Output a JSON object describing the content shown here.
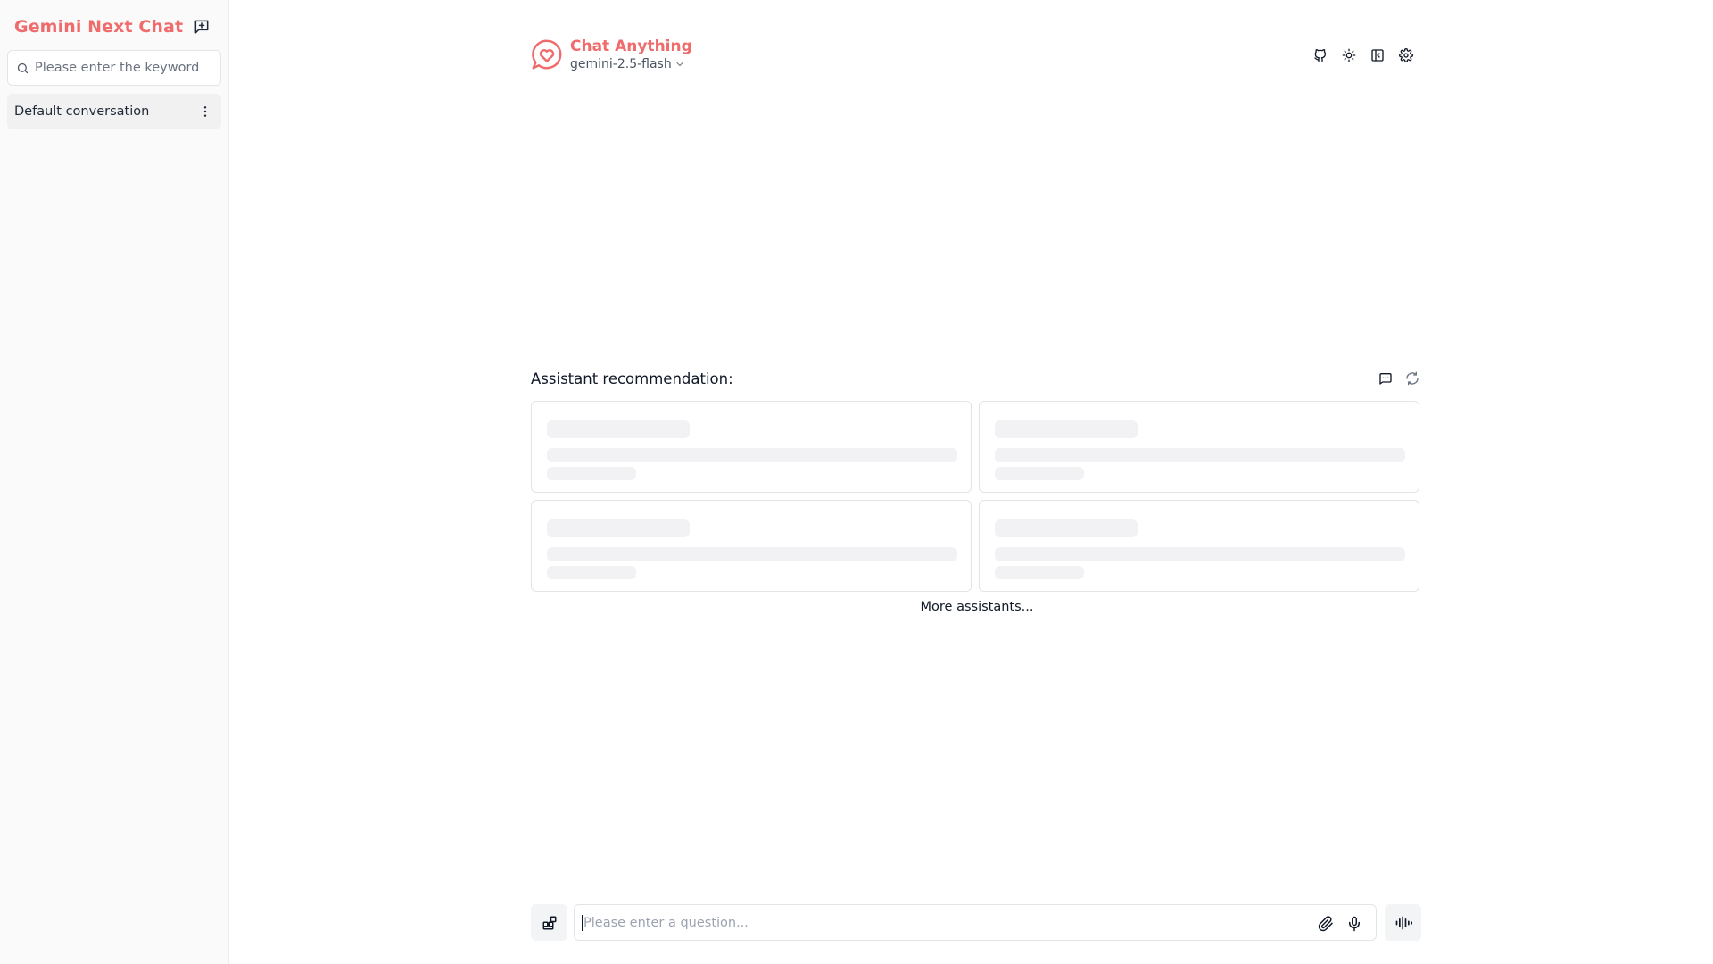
{
  "sidebar": {
    "brand_title": "Gemini Next Chat",
    "new_chat_icon": "message-plus-icon",
    "search": {
      "placeholder": "Please enter the keyword",
      "value": ""
    },
    "conversations": [
      {
        "label": "Default conversation",
        "menu_icon": "more-vertical-icon"
      }
    ]
  },
  "header": {
    "logo_icon": "heart-chat-icon",
    "title": "Chat Anything",
    "model": "gemini-2.5-flash",
    "actions": [
      "github-icon",
      "sun-icon",
      "panel-toggle-icon",
      "settings-icon"
    ]
  },
  "recommendation": {
    "title": "Assistant recommendation:",
    "actions": [
      "chat-bubble-icon",
      "refresh-icon"
    ],
    "cards_loading": 4,
    "more_label": "More assistants..."
  },
  "composer": {
    "placeholder": "Please enter a question...",
    "value": "",
    "tools_icon": "plugin-grid-icon",
    "attach_icon": "paperclip-icon",
    "mic_icon": "microphone-icon",
    "voice_icon": "audio-waveform-icon"
  },
  "colors": {
    "brand": "#f06b6b",
    "sidebar_bg": "#fafafa",
    "skeleton": "#f2f2f4",
    "border": "#e4e4e7"
  }
}
